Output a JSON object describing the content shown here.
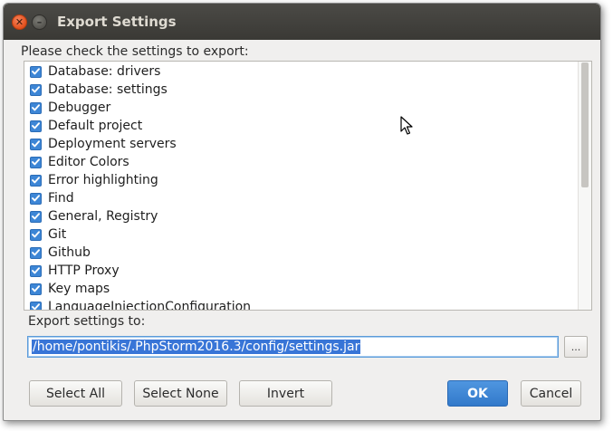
{
  "window": {
    "title": "Export Settings"
  },
  "prompt": "Please check the settings to export:",
  "settings": {
    "items": [
      {
        "label": "Database: drivers",
        "checked": true
      },
      {
        "label": "Database: settings",
        "checked": true
      },
      {
        "label": "Debugger",
        "checked": true
      },
      {
        "label": "Default project",
        "checked": true
      },
      {
        "label": "Deployment servers",
        "checked": true
      },
      {
        "label": "Editor Colors",
        "checked": true
      },
      {
        "label": "Error highlighting",
        "checked": true
      },
      {
        "label": "Find",
        "checked": true
      },
      {
        "label": "General, Registry",
        "checked": true
      },
      {
        "label": "Git",
        "checked": true
      },
      {
        "label": "Github",
        "checked": true
      },
      {
        "label": "HTTP Proxy",
        "checked": true
      },
      {
        "label": "Key maps",
        "checked": true
      },
      {
        "label": "LanguageInjectionConfiguration",
        "checked": true
      }
    ]
  },
  "export": {
    "label": "Export settings to:",
    "path": "/home/pontikis/.PhpStorm2016.3/config/settings.jar",
    "browse_label": "..."
  },
  "buttons": {
    "select_all": "Select All",
    "select_none": "Select None",
    "invert": "Invert",
    "ok": "OK",
    "cancel": "Cancel"
  },
  "colors": {
    "accent": "#3d86d6",
    "selection": "#3875d7",
    "titlebar": "#3c3b37",
    "close_button": "#e95420"
  }
}
